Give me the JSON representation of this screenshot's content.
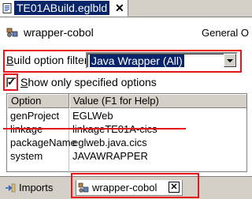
{
  "editor_tab": {
    "title": "TE01ABuild.eglbld",
    "close_glyph": "✕",
    "icon": "document-icon"
  },
  "header": {
    "title": "wrapper-cobol",
    "section": "General O",
    "icon": "build-config-icon"
  },
  "filter": {
    "label_prefix": "B",
    "label_rest": "uild option filter",
    "selected": "Java Wrapper (All)"
  },
  "show_only": {
    "label_prefix": "S",
    "label_rest": "how only specified options",
    "checked": true
  },
  "table": {
    "columns": [
      "Option",
      "Value (F1 for Help)"
    ],
    "rows": [
      {
        "option": "genProject",
        "value": "EGLWeb"
      },
      {
        "option": "linkage",
        "value": "linkageTE01A-cics"
      },
      {
        "option": "packageName",
        "value": "eglweb.java.cics"
      },
      {
        "option": "system",
        "value": "JAVAWRAPPER"
      }
    ]
  },
  "bottom_tabs": [
    {
      "label": "Imports",
      "icon": "imports-icon"
    },
    {
      "label": "wrapper-cobol",
      "icon": "build-config-icon",
      "close_glyph": "✕"
    }
  ],
  "colors": {
    "highlight": "#e8141c",
    "selection": "#0a246a",
    "chrome": "#d4d0c8"
  }
}
